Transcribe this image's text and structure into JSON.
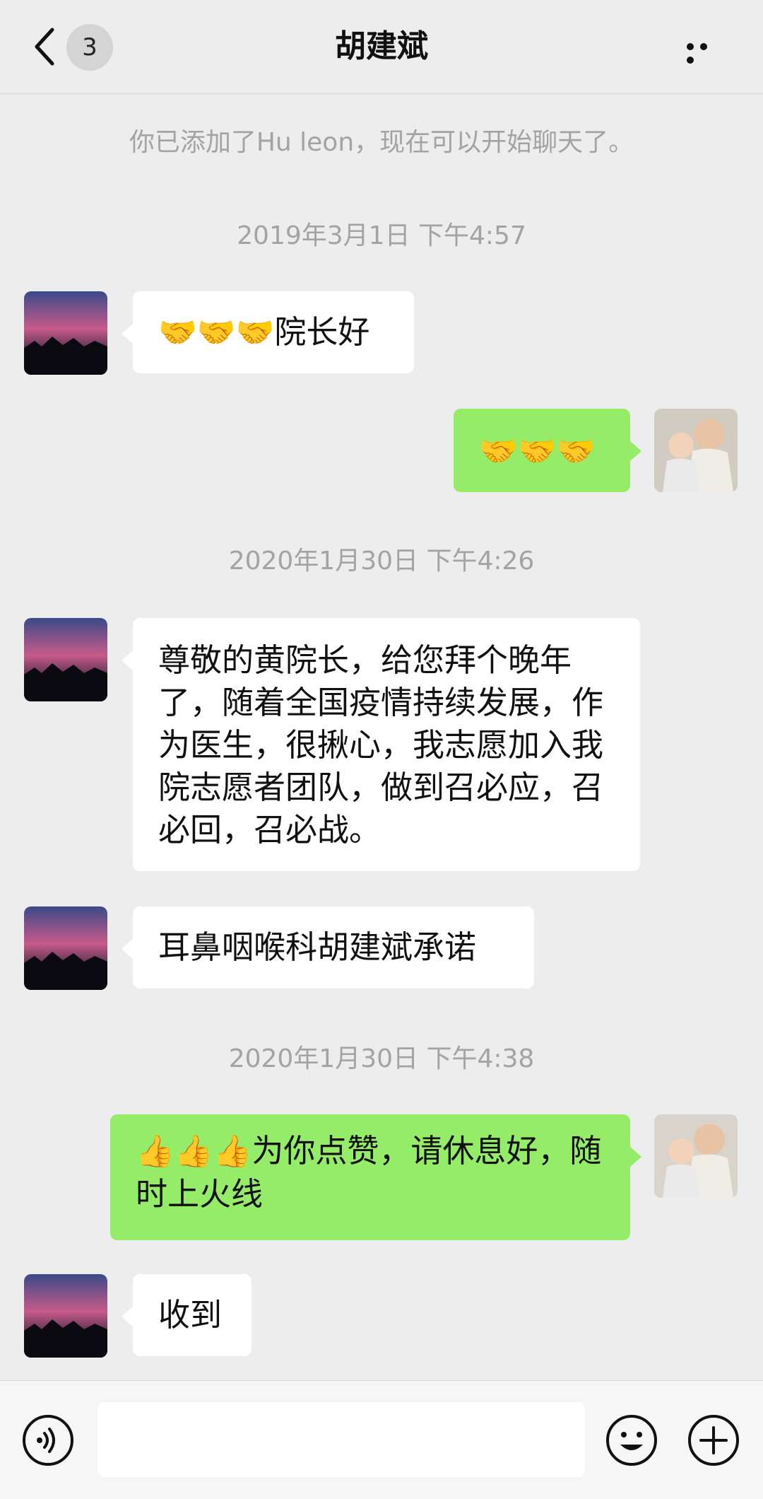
{
  "header": {
    "back_icon": "chevron-left-icon",
    "unread_count": "3",
    "title": "胡建斌",
    "more_icon": "more-dots-icon"
  },
  "system": {
    "added_notice": "你已添加了Hu leon，现在可以开始聊天了。"
  },
  "timestamps": [
    "2019年3月1日 下午4:57",
    "2020年1月30日 下午4:26",
    "2020年1月30日 下午4:38"
  ],
  "messages": [
    {
      "side": "in",
      "emoji": "🤝🤝🤝",
      "text": "院长好"
    },
    {
      "side": "out",
      "emoji": "🤝🤝🤝",
      "text": ""
    },
    {
      "side": "in",
      "text": "尊敬的黄院长，给您拜个晚年了，随着全国疫情持续发展，作为医生，很揪心，我志愿加入我院志愿者团队，做到召必应，召必回，召必战。"
    },
    {
      "side": "in",
      "text": "耳鼻咽喉科胡建斌承诺"
    },
    {
      "side": "out",
      "emoji": "👍👍👍",
      "text": "为你点赞，请休息好，随时上火线"
    },
    {
      "side": "in",
      "text": "收到"
    }
  ],
  "input_bar": {
    "placeholder": "",
    "voice_icon": "voice-icon",
    "emoji_icon": "emoji-icon",
    "plus_icon": "plus-icon"
  },
  "colors": {
    "background": "#ededed",
    "incoming_bubble": "#ffffff",
    "outgoing_bubble": "#95ec69",
    "system_text": "#a3a3a3"
  }
}
